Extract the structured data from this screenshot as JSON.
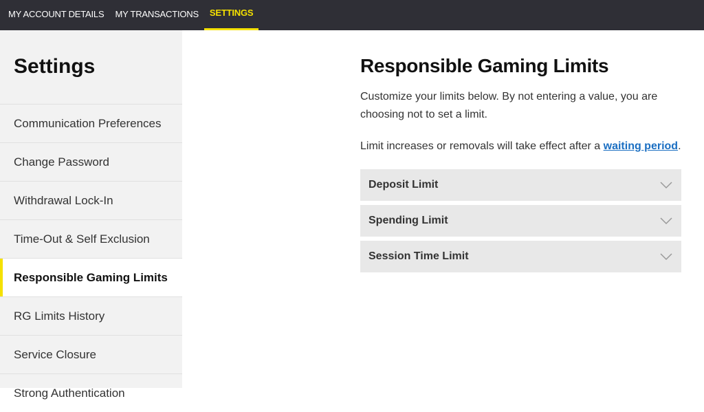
{
  "topnav": {
    "tabs": [
      {
        "label": "MY ACCOUNT DETAILS"
      },
      {
        "label": "MY TRANSACTIONS"
      },
      {
        "label": "SETTINGS"
      }
    ]
  },
  "sidebar": {
    "title": "Settings",
    "items": [
      {
        "label": "Communication Preferences"
      },
      {
        "label": "Change Password"
      },
      {
        "label": "Withdrawal Lock-In"
      },
      {
        "label": "Time-Out & Self Exclusion"
      },
      {
        "label": "Responsible Gaming Limits"
      },
      {
        "label": "RG Limits History"
      },
      {
        "label": "Service Closure"
      },
      {
        "label": "Strong Authentication"
      }
    ]
  },
  "main": {
    "title": "Responsible Gaming Limits",
    "intro": "Customize your limits below. By not entering a value, you are choosing not to set a limit.",
    "notice_prefix": "Limit increases or removals will take effect after a ",
    "notice_link": "waiting period",
    "notice_suffix": ".",
    "limits": [
      {
        "label": "Deposit Limit",
        "icon": "chevron-down-icon"
      },
      {
        "label": "Spending Limit",
        "icon": "chevron-down-icon"
      },
      {
        "label": "Session Time Limit",
        "icon": "chevron-down-icon"
      }
    ]
  },
  "colors": {
    "nav_bg": "#2f2f36",
    "accent": "#f5e100",
    "sidebar_bg": "#f2f2f2",
    "accordion_bg": "#e8e8e8",
    "link": "#1b6fc2"
  }
}
